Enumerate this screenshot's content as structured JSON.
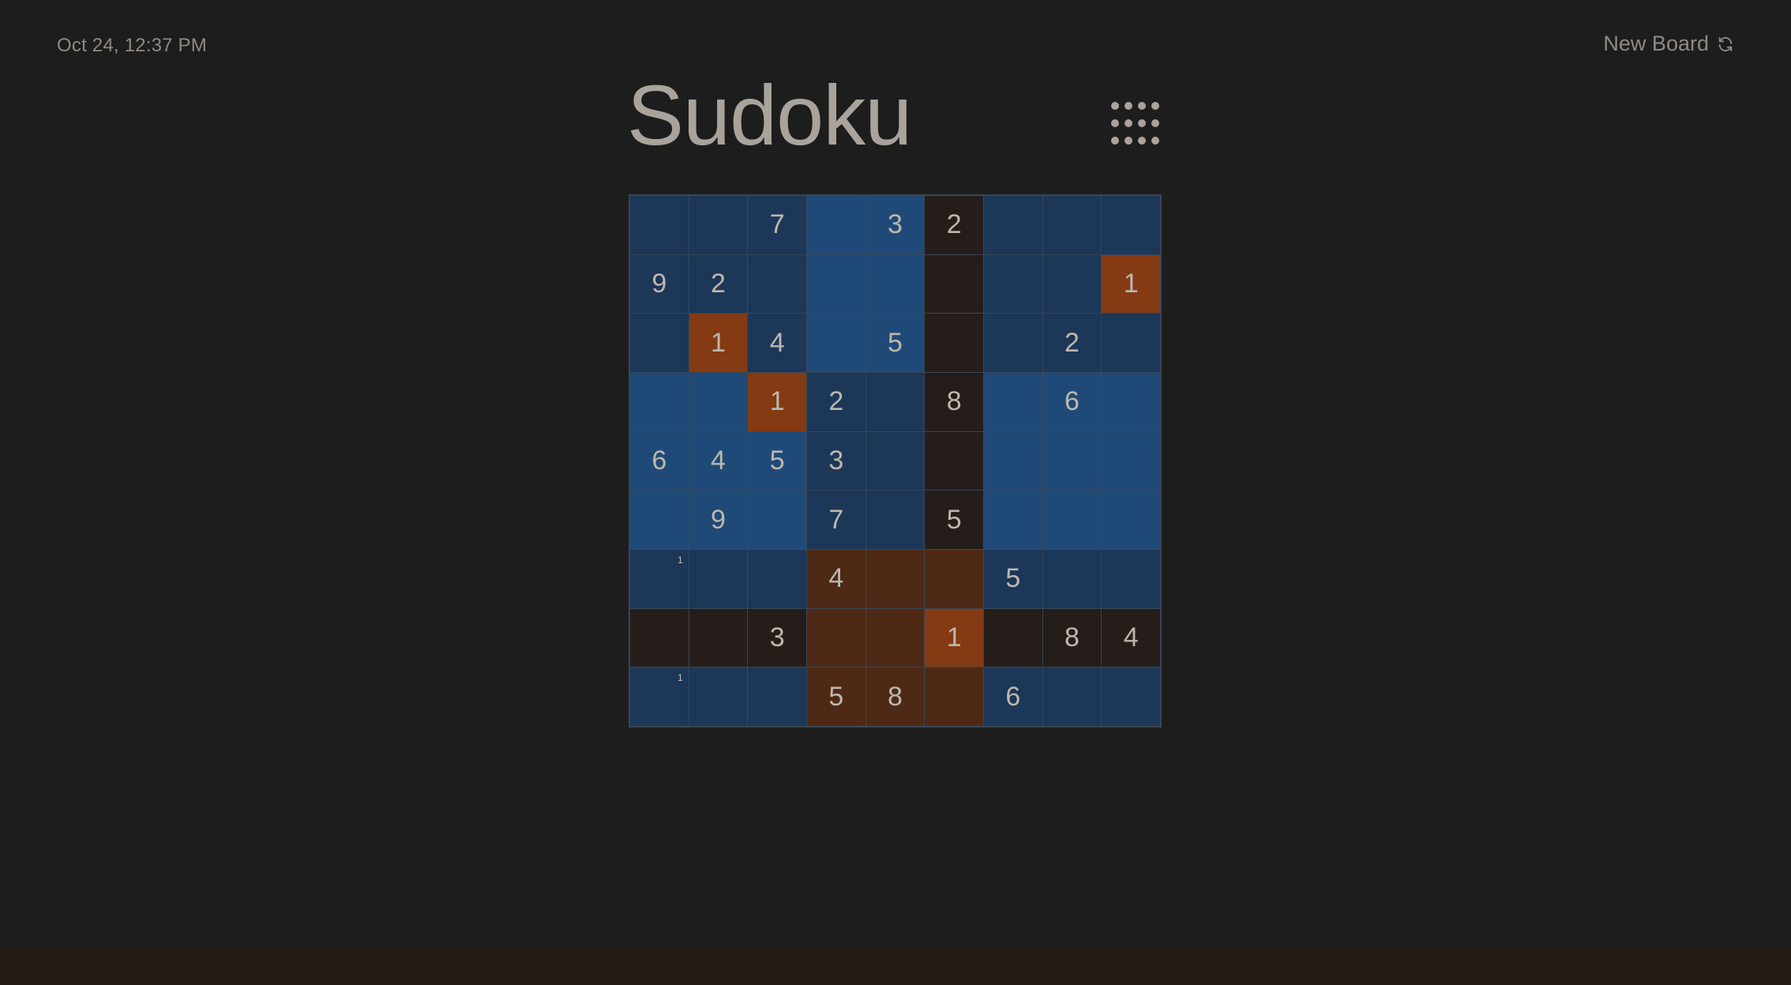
{
  "header": {
    "timestamp": "Oct 24, 12:37 PM",
    "new_board_label": "New Board",
    "title": "Sudoku"
  },
  "colors": {
    "A": "#1c3758",
    "B": "#1f4a78",
    "D": "#251d1a",
    "R": "#4e2915",
    "O": "#843a12",
    "bottom_bar": "#231b16"
  },
  "board": {
    "cells": [
      [
        "",
        "",
        "7",
        "",
        "3",
        "2",
        "",
        "",
        ""
      ],
      [
        "9",
        "2",
        "",
        "",
        "",
        "",
        "",
        "",
        "1"
      ],
      [
        "",
        "1",
        "4",
        "",
        "5",
        "",
        "",
        "2",
        ""
      ],
      [
        "",
        "",
        "1",
        "2",
        "",
        "8",
        "",
        "6",
        ""
      ],
      [
        "6",
        "4",
        "5",
        "3",
        "",
        "",
        "",
        "",
        ""
      ],
      [
        "",
        "9",
        "",
        "7",
        "",
        "5",
        "",
        "",
        ""
      ],
      [
        "",
        "",
        "",
        "4",
        "",
        "",
        "5",
        "",
        ""
      ],
      [
        "",
        "",
        "3",
        "",
        "",
        "1",
        "",
        "8",
        "4"
      ],
      [
        "",
        "",
        "",
        "5",
        "8",
        "",
        "6",
        "",
        ""
      ]
    ],
    "notes": [
      [
        "",
        "",
        "",
        "",
        "",
        "",
        "",
        "",
        ""
      ],
      [
        "",
        "",
        "",
        "",
        "",
        "",
        "",
        "",
        ""
      ],
      [
        "",
        "",
        "",
        "",
        "",
        "",
        "",
        "",
        ""
      ],
      [
        "",
        "",
        "",
        "",
        "",
        "",
        "",
        "",
        ""
      ],
      [
        "",
        "",
        "",
        "",
        "",
        "",
        "",
        "",
        ""
      ],
      [
        "",
        "",
        "",
        "",
        "",
        "",
        "",
        "",
        ""
      ],
      [
        "1",
        "",
        "",
        "",
        "",
        "",
        "",
        "",
        ""
      ],
      [
        "",
        "",
        "",
        "",
        "",
        "",
        "",
        "",
        ""
      ],
      [
        "1",
        "",
        "",
        "",
        "",
        "",
        "",
        "",
        ""
      ]
    ],
    "shading": [
      [
        "A",
        "A",
        "A",
        "B",
        "B",
        "D",
        "A",
        "A",
        "A"
      ],
      [
        "A",
        "A",
        "A",
        "B",
        "B",
        "D",
        "A",
        "A",
        "O"
      ],
      [
        "A",
        "O",
        "A",
        "B",
        "B",
        "D",
        "A",
        "A",
        "A"
      ],
      [
        "B",
        "B",
        "O",
        "A",
        "A",
        "D",
        "B",
        "B",
        "B"
      ],
      [
        "B",
        "B",
        "B",
        "A",
        "A",
        "D",
        "B",
        "B",
        "B"
      ],
      [
        "B",
        "B",
        "B",
        "A",
        "A",
        "D",
        "B",
        "B",
        "B"
      ],
      [
        "A",
        "A",
        "A",
        "R",
        "R",
        "R",
        "A",
        "A",
        "A"
      ],
      [
        "D",
        "D",
        "D",
        "R",
        "R",
        "O",
        "D",
        "D",
        "D"
      ],
      [
        "A",
        "A",
        "A",
        "R",
        "R",
        "R",
        "A",
        "A",
        "A"
      ]
    ]
  }
}
